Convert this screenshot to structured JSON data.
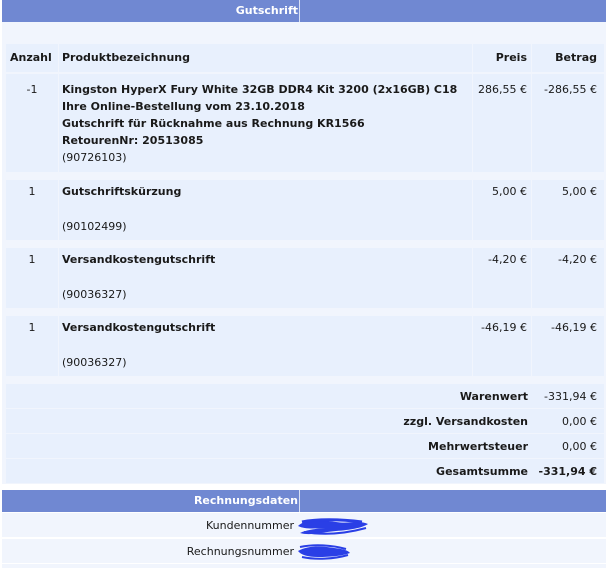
{
  "credit_header": {
    "title": "Gutschrift"
  },
  "columns": {
    "qty": "Anzahl",
    "product": "Produktbezeichnung",
    "price": "Preis",
    "amount": "Betrag"
  },
  "items": [
    {
      "qty": "-1",
      "lines": [
        "Kingston HyperX Fury White 32GB DDR4 Kit 3200 (2x16GB) C18",
        "Ihre Online-Bestellung vom 23.10.2018",
        "Gutschrift für Rücknahme aus Rechnung KR1566",
        "RetourenNr: 20513085"
      ],
      "code": "(90726103)",
      "price": "286,55 €",
      "amount": "-286,55 €"
    },
    {
      "qty": "1",
      "lines": [
        "Gutschriftskürzung"
      ],
      "code": "(90102499)",
      "price": "5,00 €",
      "amount": "5,00 €"
    },
    {
      "qty": "1",
      "lines": [
        "Versandkostengutschrift"
      ],
      "code": "(90036327)",
      "price": "-4,20 €",
      "amount": "-4,20 €"
    },
    {
      "qty": "1",
      "lines": [
        "Versandkostengutschrift"
      ],
      "code": "(90036327)",
      "price": "-46,19 €",
      "amount": "-46,19 €"
    }
  ],
  "totals": [
    {
      "label": "Warenwert",
      "value": "-331,94 €"
    },
    {
      "label": "zzgl. Versandkosten",
      "value": "0,00 €"
    },
    {
      "label": "Mehrwertsteuer",
      "value": "0,00 €"
    },
    {
      "label": "Gesamtsumme",
      "value": "-331,94 €"
    }
  ],
  "invoice_header": {
    "title": "Rechnungsdaten"
  },
  "invoice": {
    "customer_label": "Kundennummer",
    "invoice_label": "Rechnungsnummer"
  },
  "colors": {
    "header_bar": "#7088d2",
    "panel": "#f1f5fd",
    "cell": "#e8f0fd",
    "redaction": "#2a3fe6"
  }
}
